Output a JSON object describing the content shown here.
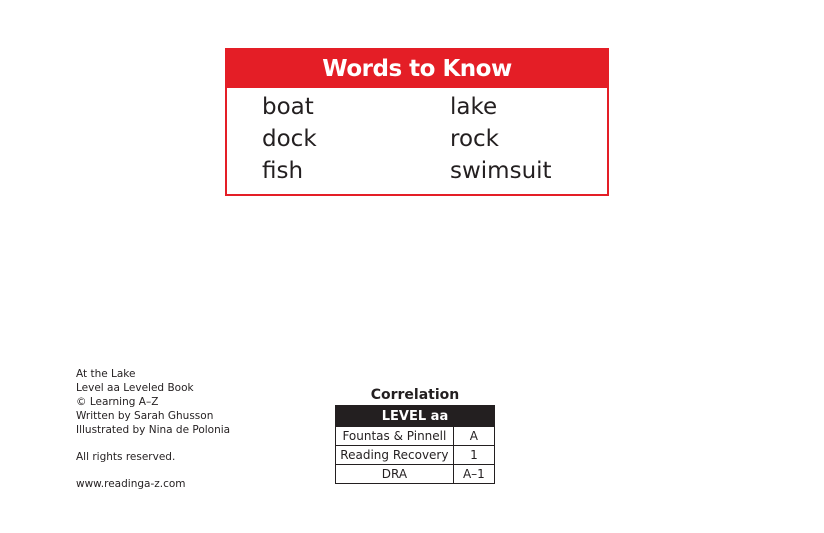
{
  "words_to_know": {
    "title": "Words to Know",
    "words": [
      "boat",
      "lake",
      "dock",
      "rock",
      "fish",
      "swimsuit"
    ]
  },
  "credits": {
    "book_title": "At the Lake",
    "level_line": "Level aa Leveled Book",
    "copyright": "© Learning A–Z",
    "author": "Written by Sarah Ghusson",
    "illustrator": "Illustrated by Nina de Polonia",
    "rights": "All rights reserved.",
    "website": "www.readinga-z.com"
  },
  "correlation": {
    "title": "Correlation",
    "level_header": "LEVEL aa",
    "rows": [
      {
        "system": "Fountas & Pinnell",
        "level": "A"
      },
      {
        "system": "Reading Recovery",
        "level": "1"
      },
      {
        "system": "DRA",
        "level": "A–1"
      }
    ]
  },
  "colors": {
    "accent_red": "#e41e26",
    "text_dark": "#231f20",
    "header_black": "#231f20"
  }
}
